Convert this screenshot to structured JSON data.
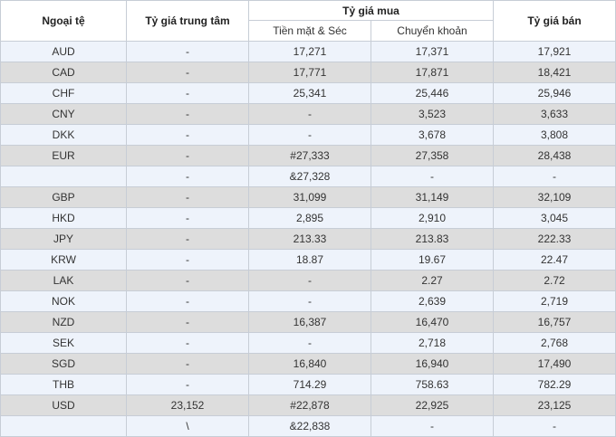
{
  "headers": {
    "currency": "Ngoại tệ",
    "central_rate": "Tỷ giá trung tâm",
    "buy_rate": "Tỷ giá mua",
    "buy_cash": "Tiền mặt & Séc",
    "buy_transfer": "Chuyển khoản",
    "sell_rate": "Tỷ giá bán"
  },
  "rows": [
    [
      "AUD",
      "-",
      "17,271",
      "17,371",
      "17,921"
    ],
    [
      "CAD",
      "-",
      "17,771",
      "17,871",
      "18,421"
    ],
    [
      "CHF",
      "-",
      "25,341",
      "25,446",
      "25,946"
    ],
    [
      "CNY",
      "-",
      "-",
      "3,523",
      "3,633"
    ],
    [
      "DKK",
      "-",
      "-",
      "3,678",
      "3,808"
    ],
    [
      "EUR",
      "-",
      "#27,333",
      "27,358",
      "28,438"
    ],
    [
      "",
      "-",
      "&27,328",
      "-",
      "-"
    ],
    [
      "GBP",
      "-",
      "31,099",
      "31,149",
      "32,109"
    ],
    [
      "HKD",
      "-",
      "2,895",
      "2,910",
      "3,045"
    ],
    [
      "JPY",
      "-",
      "213.33",
      "213.83",
      "222.33"
    ],
    [
      "KRW",
      "-",
      "18.87",
      "19.67",
      "22.47"
    ],
    [
      "LAK",
      "-",
      "-",
      "2.27",
      "2.72"
    ],
    [
      "NOK",
      "-",
      "-",
      "2,639",
      "2,719"
    ],
    [
      "NZD",
      "-",
      "16,387",
      "16,470",
      "16,757"
    ],
    [
      "SEK",
      "-",
      "-",
      "2,718",
      "2,768"
    ],
    [
      "SGD",
      "-",
      "16,840",
      "16,940",
      "17,490"
    ],
    [
      "THB",
      "-",
      "714.29",
      "758.63",
      "782.29"
    ],
    [
      "USD",
      "23,152",
      "#22,878",
      "22,925",
      "23,125"
    ],
    [
      "",
      "\\",
      "&22,838",
      "-",
      "-"
    ]
  ]
}
